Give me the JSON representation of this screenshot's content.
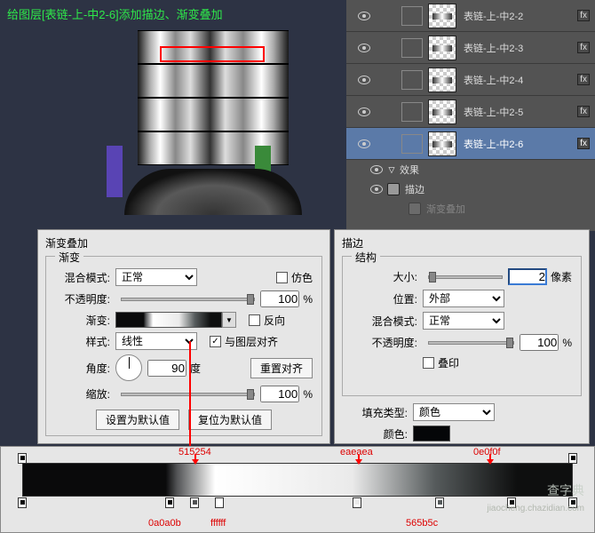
{
  "instruction": "给图层[表链-上-中2-6]添加描边、渐变叠加",
  "layers": {
    "items": [
      {
        "name": "表链-上-中2-2",
        "selected": false
      },
      {
        "name": "表链-上-中2-3",
        "selected": false
      },
      {
        "name": "表链-上-中2-4",
        "selected": false
      },
      {
        "name": "表链-上-中2-5",
        "selected": false
      },
      {
        "name": "表链-上-中2-6",
        "selected": true
      }
    ],
    "effects_label": "效果",
    "effects": [
      "描边",
      "渐变叠加"
    ],
    "fx_badge": "fx"
  },
  "gradient_overlay": {
    "panel_title": "渐变叠加",
    "group_label": "渐变",
    "blend_mode_label": "混合模式:",
    "blend_mode_value": "正常",
    "dither_label": "仿色",
    "dither_checked": false,
    "opacity_label": "不透明度:",
    "opacity_value": "100",
    "opacity_unit": "%",
    "gradient_label": "渐变:",
    "reverse_label": "反向",
    "reverse_checked": false,
    "style_label": "样式:",
    "style_value": "线性",
    "align_label": "与图层对齐",
    "align_checked": true,
    "angle_label": "角度:",
    "angle_value": "90",
    "angle_unit": "度",
    "reset_align_btn": "重置对齐",
    "scale_label": "缩放:",
    "scale_value": "100",
    "scale_unit": "%",
    "set_default_btn": "设置为默认值",
    "reset_default_btn": "复位为默认值"
  },
  "stroke": {
    "panel_title": "描边",
    "group_label": "结构",
    "size_label": "大小:",
    "size_value": "2",
    "size_unit": "像素",
    "position_label": "位置:",
    "position_value": "外部",
    "blend_mode_label": "混合模式:",
    "blend_mode_value": "正常",
    "opacity_label": "不透明度:",
    "opacity_value": "100",
    "opacity_unit": "%",
    "overprint_label": "叠印",
    "overprint_checked": false,
    "fill_type_label": "填充类型:",
    "fill_type_value": "颜色",
    "color_label": "颜色:",
    "color_hex": "#050608"
  },
  "gradient_stops": {
    "hex": [
      "0a0a0b",
      "515254",
      "ffffff",
      "eaeaea",
      "565b5c",
      "0e0f0f"
    ]
  },
  "watermark": {
    "main": "查字典",
    "sub": "jiaocheng.chazidian.com"
  }
}
